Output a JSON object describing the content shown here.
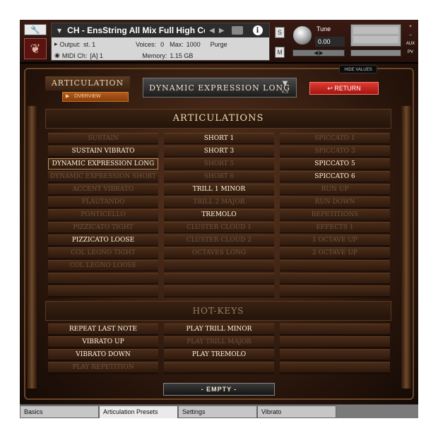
{
  "header": {
    "instrument_title": "CH - EnsString All Mix Full High Cor",
    "output_label": "Output:",
    "output_value": "st. 1",
    "voices_label": "Voices:",
    "voices_value": "0",
    "max_label": "Max:",
    "max_value": "1000",
    "purge_label": "Purge",
    "midi_label": "MIDI Ch:",
    "midi_value": "[A] 1",
    "memory_label": "Memory:",
    "memory_value": "1.15 GB",
    "solo_label": "S",
    "mute_label": "M",
    "tune_label": "Tune",
    "tune_value": "0.00",
    "pan_label": "◀|▶",
    "aux_label": "AUX",
    "pv_label": "PV",
    "close_glyph": "×",
    "minus_glyph": "–",
    "hide_values_label": "HIDE VALUES"
  },
  "articulation_panel": {
    "label": "ARTICULATION",
    "overview_button": "OVERVIEW",
    "current": "DYNAMIC EXPRESSION LONG",
    "ks_label": "KS",
    "return_button": "RETURN"
  },
  "articulations_heading": "ARTICULATIONS",
  "articulations": {
    "col1": [
      {
        "label": "SUSTAIN",
        "state": "dim"
      },
      {
        "label": "SUSTAIN VIBRATO",
        "state": "bright"
      },
      {
        "label": "DYNAMIC EXPRESSION LONG",
        "state": "selected"
      },
      {
        "label": "DYNAMIC EXPRESSION SHORT",
        "state": "dim"
      },
      {
        "label": "ACCENT VIBRATO",
        "state": "dim"
      },
      {
        "label": "FLAUTANDO",
        "state": "dim"
      },
      {
        "label": "PONTICELLO",
        "state": "dim"
      },
      {
        "label": "PIZZICATO TIGHT",
        "state": "dim"
      },
      {
        "label": "PIZZICATO LOOSE",
        "state": "bright"
      },
      {
        "label": "COL LEGNO TIGHT",
        "state": "dim"
      },
      {
        "label": "COL LEGNO LOOSE",
        "state": "dim"
      },
      {
        "label": "",
        "state": "dim"
      },
      {
        "label": "",
        "state": "dim"
      }
    ],
    "col2": [
      {
        "label": "SHORT 1",
        "state": "bright"
      },
      {
        "label": "SHORT 3",
        "state": "bright"
      },
      {
        "label": "SHORT 5",
        "state": "dim"
      },
      {
        "label": "SHORT 6",
        "state": "dim"
      },
      {
        "label": "TRILL 1 MINOR",
        "state": "bright"
      },
      {
        "label": "TRILL 2 MAJOR",
        "state": "dim"
      },
      {
        "label": "TREMOLO",
        "state": "bright"
      },
      {
        "label": "CLUSTER CLOUD 1",
        "state": "dim"
      },
      {
        "label": "CLUSTER CLOUD 2",
        "state": "dim"
      },
      {
        "label": "OCTAVES LONG",
        "state": "dim"
      },
      {
        "label": "",
        "state": "dim"
      },
      {
        "label": "",
        "state": "dim"
      },
      {
        "label": "",
        "state": "dim"
      }
    ],
    "col3": [
      {
        "label": "SPICCATO 1",
        "state": "dim"
      },
      {
        "label": "SPICCATO 3",
        "state": "dim"
      },
      {
        "label": "SPICCATO 5",
        "state": "bright"
      },
      {
        "label": "SPICCATO 6",
        "state": "bright"
      },
      {
        "label": "RUN UP",
        "state": "dim"
      },
      {
        "label": "RUN DOWN",
        "state": "dim"
      },
      {
        "label": "REPETITIONS",
        "state": "dim"
      },
      {
        "label": "EFFECTS 1",
        "state": "dim"
      },
      {
        "label": "1 OCTAVE UP",
        "state": "dim"
      },
      {
        "label": "2 OCTAVE UP",
        "state": "dim"
      },
      {
        "label": "",
        "state": "dim"
      },
      {
        "label": "",
        "state": "dim"
      },
      {
        "label": "",
        "state": "dim"
      }
    ]
  },
  "hotkeys_heading": "HOT-KEYS",
  "hotkeys": {
    "col1": [
      {
        "label": "REPEAT LAST NOTE",
        "state": "bright"
      },
      {
        "label": "VIBRATO UP",
        "state": "bright"
      },
      {
        "label": "VIBRATO DOWN",
        "state": "bright"
      },
      {
        "label": "PLAY REPETITION",
        "state": "dim"
      }
    ],
    "col2": [
      {
        "label": "PLAY TRILL MINOR",
        "state": "bright"
      },
      {
        "label": "PLAY TRILL MAJOR",
        "state": "dim"
      },
      {
        "label": "PLAY TREMOLO",
        "state": "bright"
      },
      {
        "label": "",
        "state": "dim"
      }
    ],
    "col3": [
      {
        "label": "",
        "state": "dim"
      },
      {
        "label": "",
        "state": "dim"
      },
      {
        "label": "",
        "state": "dim"
      },
      {
        "label": "",
        "state": "dim"
      }
    ]
  },
  "empty_bar": "- EMPTY -",
  "tabs": [
    {
      "label": "Basics",
      "active": false
    },
    {
      "label": "Articulation Presets",
      "active": true
    },
    {
      "label": "Settings",
      "active": false
    },
    {
      "label": "Vibrato",
      "active": false
    }
  ]
}
